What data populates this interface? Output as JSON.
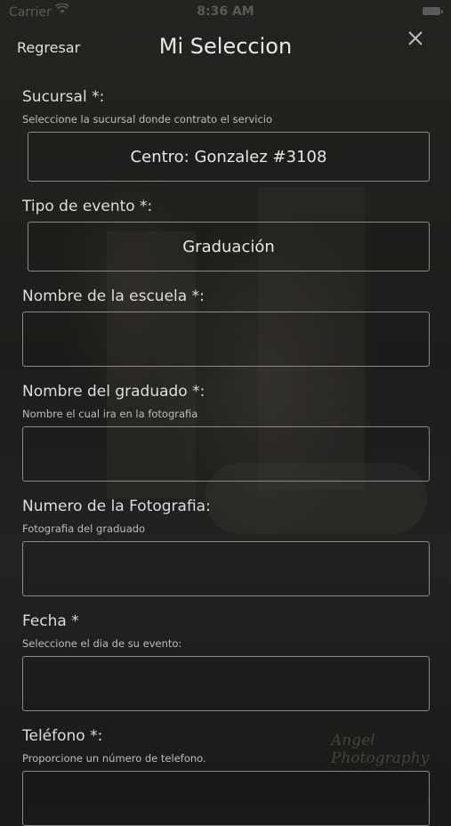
{
  "status": {
    "carrier": "Carrier",
    "time": "8:36 AM"
  },
  "nav": {
    "back_label": "Regresar",
    "title": "Mi Seleccion",
    "close_icon": "close-icon"
  },
  "form": {
    "sucursal": {
      "label": "Sucursal *:",
      "hint": "Seleccione la sucursal donde contrato el servicio",
      "value": "Centro: Gonzalez #3108"
    },
    "tipo_evento": {
      "label": "Tipo de evento *:",
      "value": "Graduación"
    },
    "escuela": {
      "label": "Nombre de la escuela *:",
      "value": ""
    },
    "graduado": {
      "label": "Nombre del graduado *:",
      "hint": "Nombre el cual ira en la fotografia",
      "value": ""
    },
    "numero_foto": {
      "label": "Numero de la Fotografia:",
      "hint": "Fotografia del graduado",
      "value": ""
    },
    "fecha": {
      "label": "Fecha *",
      "hint": "Seleccione el dia de su evento:",
      "value": ""
    },
    "telefono": {
      "label": "Teléfono *:",
      "hint": "Proporcione un número de telefono.",
      "value": ""
    }
  },
  "watermark": "Angel Photography"
}
